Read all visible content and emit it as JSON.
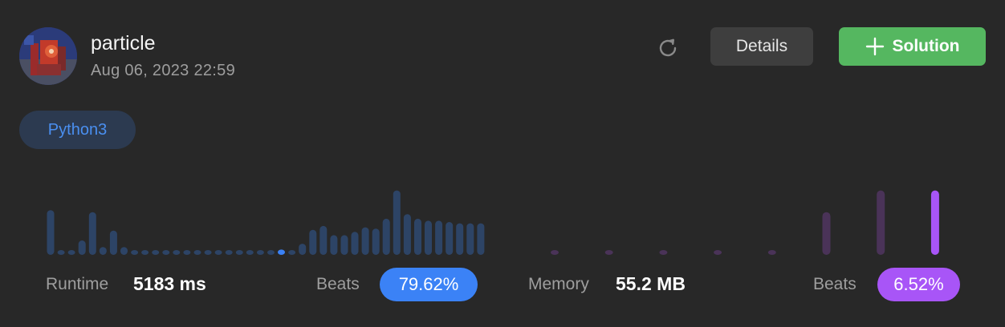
{
  "user": {
    "name": "particle",
    "submitted_at": "Aug 06, 2023 22:59"
  },
  "actions": {
    "details_label": "Details",
    "solution_label": "Solution",
    "refresh_icon": "refresh-icon",
    "plus_icon": "plus-icon"
  },
  "language": "Python3",
  "runtime": {
    "label": "Runtime",
    "value": "5183 ms",
    "beats_label": "Beats",
    "beats_value": "79.62%",
    "color": "#3b82f6"
  },
  "memory": {
    "label": "Memory",
    "value": "55.2 MB",
    "beats_label": "Beats",
    "beats_value": "6.52%",
    "color": "#a855f7"
  },
  "colors": {
    "background": "#282828",
    "runtime_bar": "#2d4466",
    "runtime_highlight": "#3b82f6",
    "memory_bar": "#4a3358",
    "memory_highlight": "#a855f7",
    "solution_button": "#55b760"
  },
  "chart_data": [
    {
      "type": "bar",
      "name": "runtime-distribution",
      "values": [
        68,
        5,
        5,
        22,
        65,
        12,
        37,
        12,
        5,
        5,
        5,
        5,
        5,
        5,
        5,
        5,
        5,
        5,
        5,
        5,
        5,
        5,
        8,
        5,
        17,
        38,
        44,
        30,
        30,
        35,
        42,
        40,
        55,
        98,
        62,
        55,
        52,
        52,
        50,
        48,
        48,
        48
      ],
      "highlight_index": 22,
      "ylim": [
        0,
        100
      ]
    },
    {
      "type": "bar",
      "name": "memory-distribution",
      "values": [
        4,
        4,
        4,
        4,
        4,
        65,
        98,
        98
      ],
      "highlight_index": 7,
      "ylim": [
        0,
        100
      ]
    }
  ]
}
